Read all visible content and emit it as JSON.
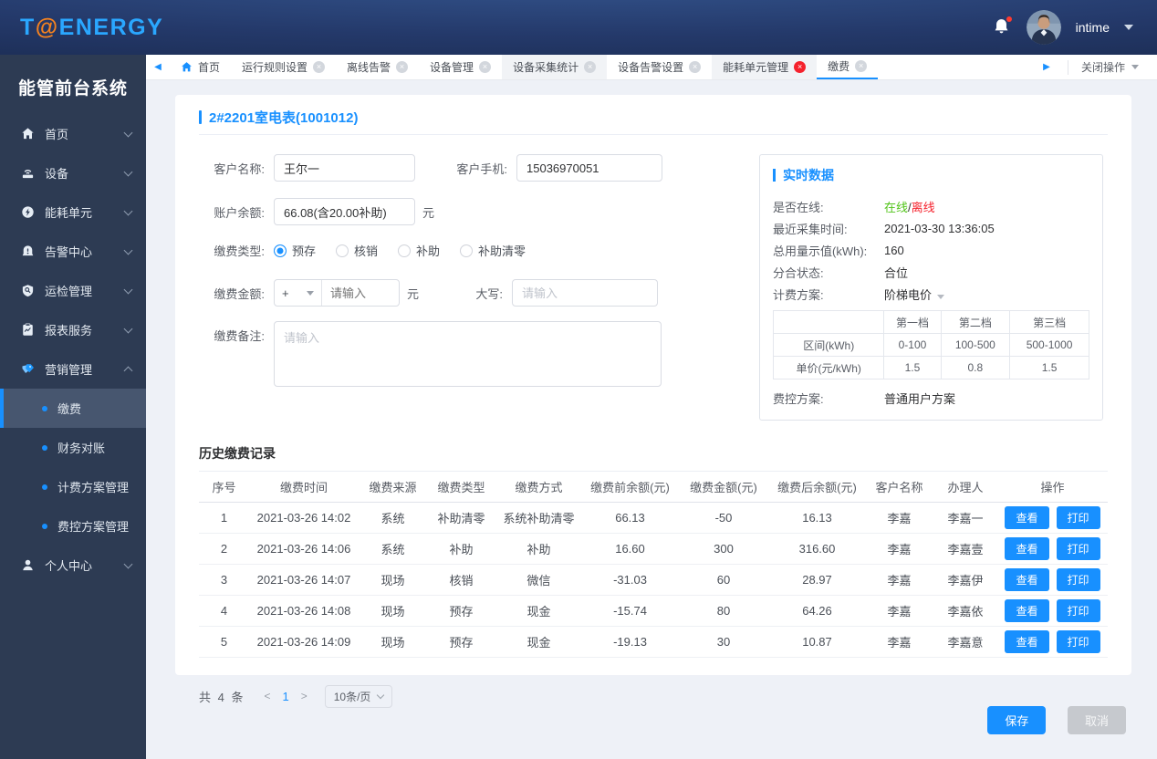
{
  "colors": {
    "primary": "#1890ff",
    "logo_blue": "#2aa7ff",
    "logo_orange": "#f5821f",
    "online_green": "#52c41a",
    "offline_red": "#f5222d",
    "sidebar_bg": "#2d3b53"
  },
  "header": {
    "logo_t": "T",
    "logo_at": "@",
    "logo_rest": "ENERGY",
    "username": "intime"
  },
  "sidebar": {
    "title": "能管前台系统",
    "menu": [
      {
        "label": "首页",
        "icon": "home"
      },
      {
        "label": "设备",
        "icon": "device"
      },
      {
        "label": "能耗单元",
        "icon": "energy"
      },
      {
        "label": "告警中心",
        "icon": "alarm"
      },
      {
        "label": "运检管理",
        "icon": "inspection"
      },
      {
        "label": "报表服务",
        "icon": "report"
      },
      {
        "label": "营销管理",
        "icon": "marketing",
        "expanded": true
      }
    ],
    "submenu": {
      "items": [
        "缴费",
        "财务对账",
        "计费方案管理",
        "费控方案管理"
      ],
      "active": "缴费"
    },
    "bottom": {
      "label": "个人中心",
      "icon": "person"
    }
  },
  "tabs": {
    "items": [
      {
        "label": "首页",
        "home": true
      },
      {
        "label": "运行规则设置",
        "closable": true
      },
      {
        "label": "离线告警",
        "closable": true
      },
      {
        "label": "设备管理",
        "closable": true
      },
      {
        "label": "设备采集统计",
        "closable": true,
        "shaded": true
      },
      {
        "label": "设备告警设置",
        "closable": true
      },
      {
        "label": "能耗单元管理",
        "closable": true,
        "shaded": true,
        "red_close": true
      },
      {
        "label": "缴费",
        "closable": true,
        "active": true
      }
    ],
    "close_menu_label": "关闭操作"
  },
  "page": {
    "title": "2#2201室电表(1001012)",
    "form": {
      "customer_name": {
        "label": "客户名称:",
        "value": "王尔一"
      },
      "customer_phone": {
        "label": "客户手机:",
        "value": "15036970051"
      },
      "balance": {
        "label": "账户余额:",
        "value": "66.08(含20.00补助)",
        "unit": "元"
      },
      "pay_type": {
        "label": "缴费类型:",
        "options": [
          "预存",
          "核销",
          "补助",
          "补助清零"
        ],
        "selected": "预存"
      },
      "amount": {
        "label": "缴费金额:",
        "sign": "+",
        "placeholder": "请输入",
        "unit": "元"
      },
      "caps": {
        "label": "大写:",
        "placeholder": "请输入"
      },
      "remark": {
        "label": "缴费备注:",
        "placeholder": "请输入"
      }
    },
    "realtime": {
      "title": "实时数据",
      "online_row": {
        "label": "是否在线:",
        "online": "在线",
        "separator": "/",
        "offline": "离线"
      },
      "rows": [
        {
          "label": "最近采集时间:",
          "value": "2021-03-30 13:36:05"
        },
        {
          "label": "总用量示值(kWh):",
          "value": "160"
        },
        {
          "label": "分合状态:",
          "value": "合位"
        },
        {
          "label": "计费方案:",
          "value": "阶梯电价"
        }
      ],
      "tier_table": {
        "col_headers": [
          "第一档",
          "第二档",
          "第三档"
        ],
        "rows": [
          {
            "header": "区间(kWh)",
            "values": [
              "0-100",
              "100-500",
              "500-1000"
            ]
          },
          {
            "header": "单价(元/kWh)",
            "values": [
              "1.5",
              "0.8",
              "1.5"
            ]
          }
        ]
      },
      "fee_plan": {
        "label": "费控方案:",
        "value": "普通用户方案"
      }
    },
    "history": {
      "title": "历史缴费记录",
      "columns": [
        "序号",
        "缴费时间",
        "缴费来源",
        "缴费类型",
        "缴费方式",
        "缴费前余额(元)",
        "缴费金额(元)",
        "缴费后余额(元)",
        "客户名称",
        "办理人",
        "操作"
      ],
      "rows": [
        [
          "1",
          "2021-03-26 14:02",
          "系统",
          "补助清零",
          "系统补助清零",
          "66.13",
          "-50",
          "16.13",
          "李嘉",
          "李嘉一"
        ],
        [
          "2",
          "2021-03-26 14:06",
          "系统",
          "补助",
          "补助",
          "16.60",
          "300",
          "316.60",
          "李嘉",
          "李嘉壹"
        ],
        [
          "3",
          "2021-03-26 14:07",
          "现场",
          "核销",
          "微信",
          "-31.03",
          "60",
          "28.97",
          "李嘉",
          "李嘉伊"
        ],
        [
          "4",
          "2021-03-26 14:08",
          "现场",
          "预存",
          "现金",
          "-15.74",
          "80",
          "64.26",
          "李嘉",
          "李嘉依"
        ],
        [
          "5",
          "2021-03-26 14:09",
          "现场",
          "预存",
          "现金",
          "-19.13",
          "30",
          "10.87",
          "李嘉",
          "李嘉意"
        ]
      ],
      "view_label": "查看",
      "print_label": "打印",
      "pagination": {
        "total": "共 4 条",
        "prev": "<",
        "page": "1",
        "next": ">",
        "page_size": "10条/页"
      }
    },
    "footer": {
      "save": "保存",
      "cancel": "取消"
    }
  }
}
